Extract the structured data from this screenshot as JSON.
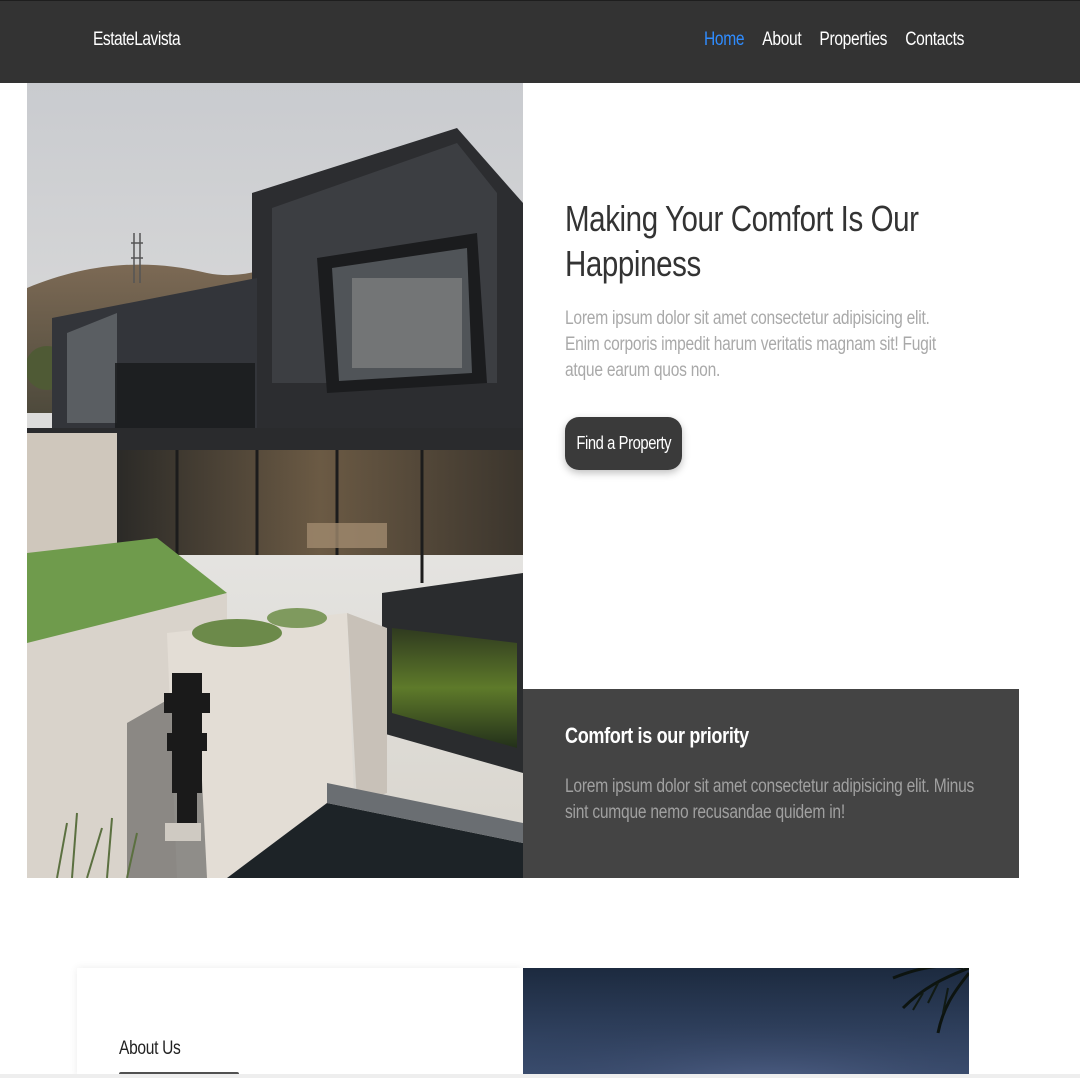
{
  "navbar": {
    "brand": "EstateLavista",
    "links": [
      {
        "label": "Home",
        "active": true
      },
      {
        "label": "About",
        "active": false
      },
      {
        "label": "Properties",
        "active": false
      },
      {
        "label": "Contacts",
        "active": false
      }
    ],
    "background": "#333333",
    "active_color": "#2f8cff"
  },
  "hero": {
    "heading": "Making Your Comfort Is Our Happiness",
    "text": "Lorem ipsum dolor sit amet consectetur adipisicing elit. Enim corporis impedit harum veritatis magnam sit! Fugit atque earum quos non.",
    "cta_label": "Find a Property"
  },
  "comfort": {
    "title": "Comfort is our priority",
    "text": "Lorem ipsum dolor sit amet consectetur adipisicing elit. Minus sint cumque nemo recusandae quidem in!",
    "background": "#444444"
  },
  "about": {
    "label": "About Us"
  }
}
